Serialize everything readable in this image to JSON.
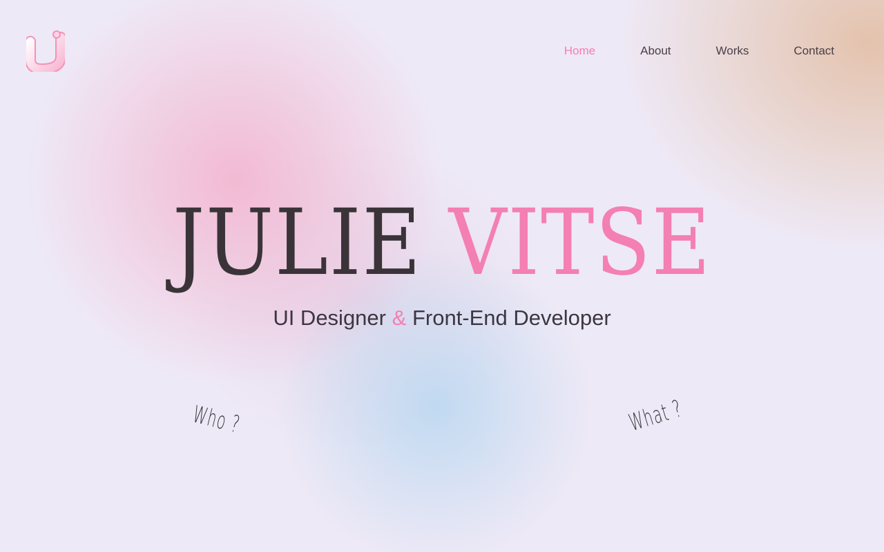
{
  "brand": {
    "logo_icon": "letter-j-logo-icon",
    "accent_color": "#f47fb2",
    "text_color": "#3a3439"
  },
  "nav": {
    "items": [
      {
        "label": "Home",
        "active": true
      },
      {
        "label": "About",
        "active": false
      },
      {
        "label": "Works",
        "active": false
      },
      {
        "label": "Contact",
        "active": false
      }
    ]
  },
  "hero": {
    "first_name": "JULIE",
    "last_name": "VITSE",
    "role_part1": "UI Designer",
    "role_amp": "&",
    "role_part2": "Front-End Developer"
  },
  "links": {
    "who": "Who ?",
    "what": "What ?"
  }
}
